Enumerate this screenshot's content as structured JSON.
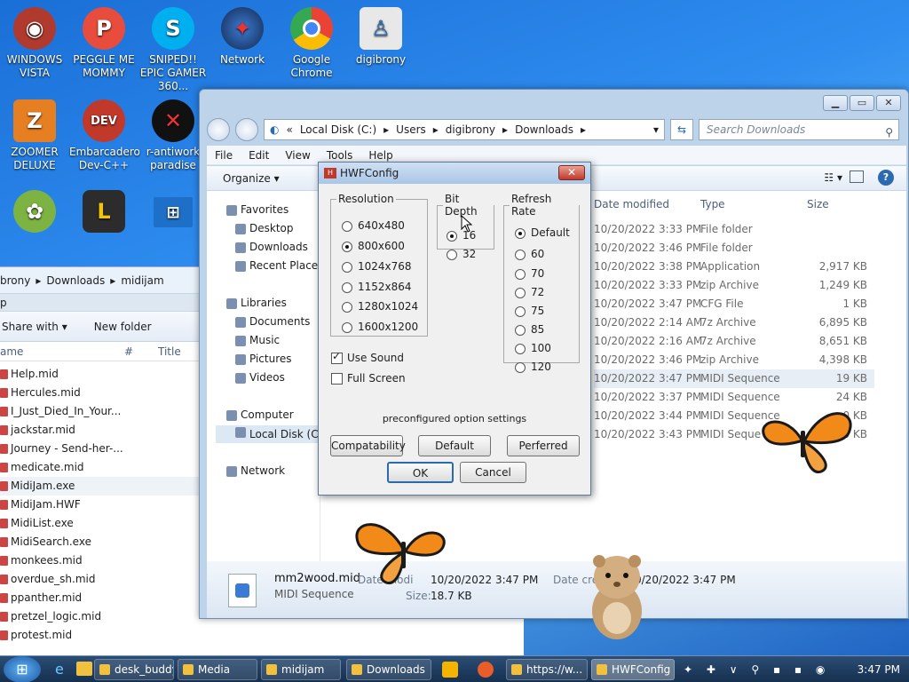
{
  "desktop_icons": [
    {
      "label": "WINDOWS VISTA",
      "color": "#c0392b"
    },
    {
      "label": "PEGGLE ME MOMMY",
      "color": "#e74c3c"
    },
    {
      "label": "SNIPED!! EPIC GAMER 360...",
      "color": "#00aff0"
    },
    {
      "label": "Network",
      "color": "#2c3e50"
    },
    {
      "label": "Google Chrome",
      "color": "#34a853"
    },
    {
      "label": "digibrony",
      "color": "#e8e8e8"
    },
    {
      "label": "ZOOMER DELUXE",
      "color": "#e67e22"
    },
    {
      "label": "Embarcadero Dev-C++",
      "color": "#c0392b"
    },
    {
      "label": "r-antiwork paradise",
      "color": "#111111"
    }
  ],
  "back_window": {
    "breadcrumb": [
      "brony",
      "Downloads",
      "midijam"
    ],
    "search_partial": "p",
    "toolbar": {
      "share": "Share with",
      "new_folder": "New folder"
    },
    "columns": {
      "name": "ame",
      "num": "#",
      "title": "Title"
    },
    "files": [
      "Help.mid",
      "Hercules.mid",
      "I_Just_Died_In_Your...",
      "jackstar.mid",
      "Journey - Send-her-...",
      "medicate.mid",
      "MidiJam.exe",
      "MidiJam.HWF",
      "MidiList.exe",
      "MidiSearch.exe",
      "monkees.mid",
      "overdue_sh.mid",
      "ppanther.mid",
      "pretzel_logic.mid",
      "protest.mid"
    ]
  },
  "main_window": {
    "breadcrumb": [
      "«",
      "Local Disk (C:)",
      "Users",
      "digibrony",
      "Downloads"
    ],
    "search_placeholder": "Search Downloads",
    "menu": [
      "File",
      "Edit",
      "View",
      "Tools",
      "Help"
    ],
    "organize": "Organize",
    "nav": {
      "favorites": "Favorites",
      "desktop": "Desktop",
      "downloads": "Downloads",
      "recent": "Recent Places",
      "libraries": "Libraries",
      "documents": "Documents",
      "music": "Music",
      "pictures": "Pictures",
      "videos": "Videos",
      "computer": "Computer",
      "localdisk": "Local Disk (C:)",
      "network": "Network"
    },
    "columns": {
      "date": "Date modified",
      "type": "Type",
      "size": "Size"
    },
    "rows": [
      {
        "date": "10/20/2022 3:33 PM",
        "type": "File folder",
        "size": ""
      },
      {
        "date": "10/20/2022 3:46 PM",
        "type": "File folder",
        "size": ""
      },
      {
        "date": "10/20/2022 3:38 PM",
        "type": "Application",
        "size": "2,917 KB"
      },
      {
        "date": "10/20/2022 3:33 PM",
        "type": "zip Archive",
        "size": "1,249 KB"
      },
      {
        "date": "10/20/2022 3:47 PM",
        "type": "CFG File",
        "size": "1 KB"
      },
      {
        "date": "10/20/2022 2:14 AM",
        "type": "7z Archive",
        "size": "6,895 KB"
      },
      {
        "date": "10/20/2022 2:16 AM",
        "type": "7z Archive",
        "size": "8,651 KB"
      },
      {
        "date": "10/20/2022 3:46 PM",
        "type": "zip Archive",
        "size": "4,398 KB"
      },
      {
        "date": "10/20/2022 3:47 PM",
        "type": "MIDI Sequence",
        "size": "19 KB"
      },
      {
        "date": "10/20/2022 3:37 PM",
        "type": "MIDI Sequence",
        "size": "24 KB"
      },
      {
        "date": "10/20/2022 3:44 PM",
        "type": "MIDI Sequence",
        "size": "0 KB"
      },
      {
        "date": "10/20/2022 3:43 PM",
        "type": "MIDI Seque",
        "size": "0 KB"
      }
    ],
    "details": {
      "filename": "mm2wood.mid",
      "filetype": "MIDI Sequence",
      "date_modified_label": "Date modi",
      "date_modified": "10/20/2022 3:47 PM",
      "size_label": "Size:",
      "size": "18.7 KB",
      "date_created_label": "Date crea",
      "date_created": "0/20/2022 3:47 PM"
    }
  },
  "dialog": {
    "title": "HWFConfig",
    "resolution": {
      "legend": "Resolution",
      "options": [
        "640x480",
        "800x600",
        "1024x768",
        "1152x864",
        "1280x1024",
        "1600x1200"
      ],
      "selected": 1
    },
    "bitdepth": {
      "legend": "Bit Depth",
      "options": [
        "16",
        "32"
      ],
      "selected": 0
    },
    "refresh": {
      "legend": "Refresh Rate",
      "options": [
        "Default",
        "60",
        "70",
        "72",
        "75",
        "85",
        "100",
        "120"
      ],
      "selected": 0
    },
    "use_sound": "Use Sound",
    "full_screen": "Full Screen",
    "preconfig_label": "preconfigured option settings",
    "buttons": {
      "compat": "Compatability",
      "default": "Default",
      "perferred": "Perferred",
      "ok": "OK",
      "cancel": "Cancel"
    }
  },
  "taskbar": {
    "items": [
      "desk_buddy",
      "Media",
      "midijam",
      "Downloads",
      "https://w...",
      "HWFConfig"
    ],
    "clock": "3:47 PM"
  }
}
